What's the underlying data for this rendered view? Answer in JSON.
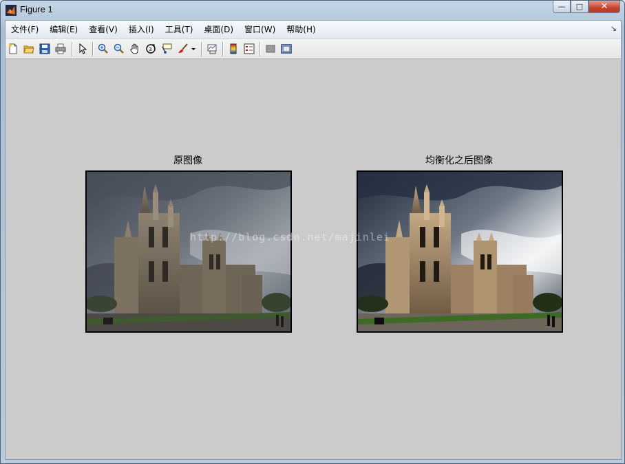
{
  "window": {
    "title": "Figure 1",
    "controls": {
      "minimize": "—",
      "maximize": "□",
      "close": "✕"
    }
  },
  "menubar": {
    "items": [
      {
        "label": "文件(F)"
      },
      {
        "label": "编辑(E)"
      },
      {
        "label": "查看(V)"
      },
      {
        "label": "插入(I)"
      },
      {
        "label": "工具(T)"
      },
      {
        "label": "桌面(D)"
      },
      {
        "label": "窗口(W)"
      },
      {
        "label": "帮助(H)"
      }
    ],
    "overflow": "↘"
  },
  "toolbar": {
    "icons": [
      "new-figure-icon",
      "open-file-icon",
      "save-icon",
      "print-icon",
      "edit-plot-arrow-icon",
      "zoom-in-icon",
      "zoom-out-icon",
      "pan-hand-icon",
      "rotate-3d-icon",
      "data-cursor-icon",
      "brush-icon",
      "brush-dropdown-icon",
      "link-plot-icon",
      "insert-colorbar-icon",
      "insert-legend-icon",
      "hide-plot-tools-icon",
      "show-plot-tools-icon"
    ]
  },
  "figure": {
    "axes": [
      {
        "title": "原图像",
        "image": "cathedral-original-photo"
      },
      {
        "title": "均衡化之后图像",
        "image": "cathedral-equalized-photo"
      }
    ],
    "watermark": "http://blog.csdn.net/majinlei"
  },
  "colors": {
    "figure_bg": "#cbcbcb",
    "window_frame": "#b6cadd",
    "close_button": "#c8442c"
  }
}
